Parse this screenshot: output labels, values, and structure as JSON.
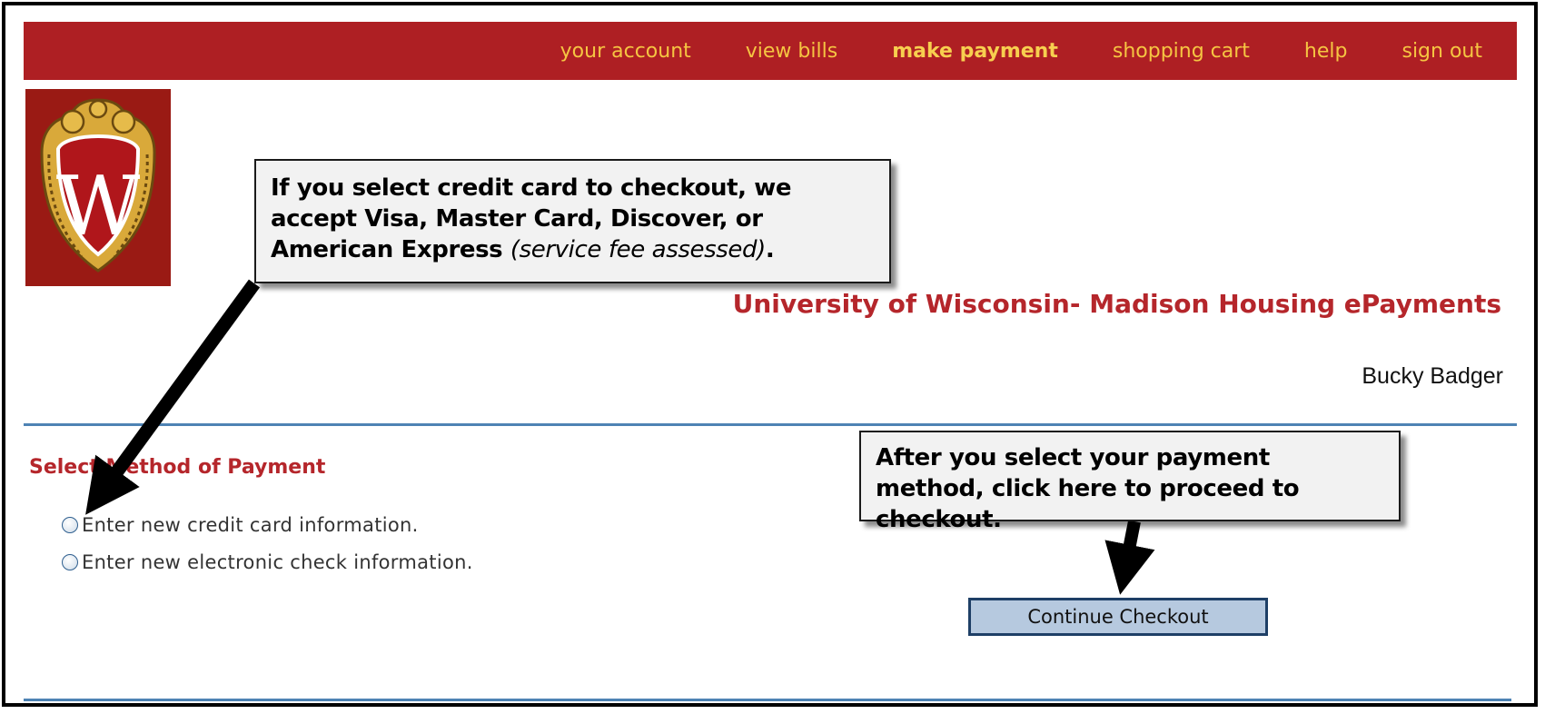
{
  "nav": {
    "items": [
      {
        "label": "your account"
      },
      {
        "label": "view bills"
      },
      {
        "label": "make payment",
        "active": true
      },
      {
        "label": "shopping cart"
      },
      {
        "label": "help"
      },
      {
        "label": "sign out"
      }
    ]
  },
  "header": {
    "site_title": "University of Wisconsin- Madison Housing ePayments",
    "user_name": "Bucky Badger"
  },
  "payment": {
    "section_title": "Select Method of Payment",
    "options": [
      {
        "label": "Enter new credit card information.",
        "selected": false
      },
      {
        "label": "Enter new electronic check information.",
        "selected": false
      }
    ],
    "continue_label": "Continue Checkout"
  },
  "callouts": {
    "credit_card_main": "If you select credit card to checkout, we accept Visa, Master Card, Discover, or American Express ",
    "credit_card_fee": "(service fee assessed)",
    "credit_card_end": ".",
    "checkout": "After you select your payment method, click here to proceed to checkout."
  },
  "colors": {
    "nav_bg": "#ae1f23",
    "nav_text": "#f5c542",
    "title_red": "#b5262b",
    "rule_blue": "#4e83b4",
    "button_bg": "#b6c9df"
  },
  "icons": {
    "logo": "uw-crest-icon",
    "radio": "radio-button-icon"
  }
}
